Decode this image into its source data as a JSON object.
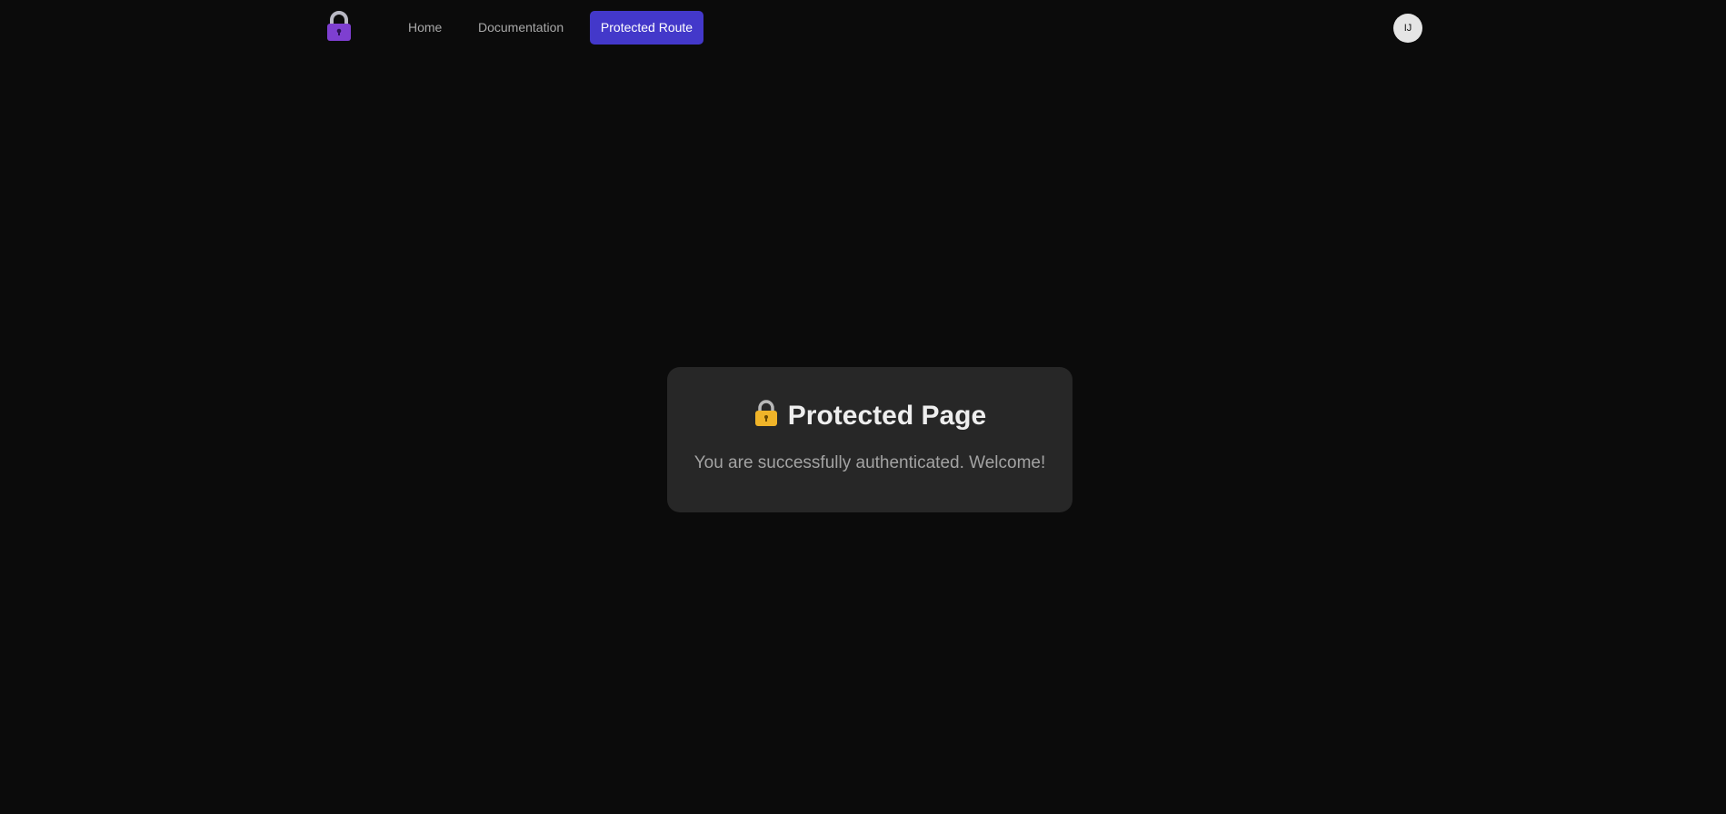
{
  "nav": {
    "logo_icon": "lock-icon",
    "links": [
      {
        "label": "Home"
      },
      {
        "label": "Documentation"
      },
      {
        "label": "Protected Route"
      }
    ],
    "active_color": "#4338ca",
    "avatar_initials": "IJ"
  },
  "card": {
    "title_icon": "lock-icon",
    "title": "Protected Page",
    "message": "You are successfully authenticated. Welcome!"
  }
}
